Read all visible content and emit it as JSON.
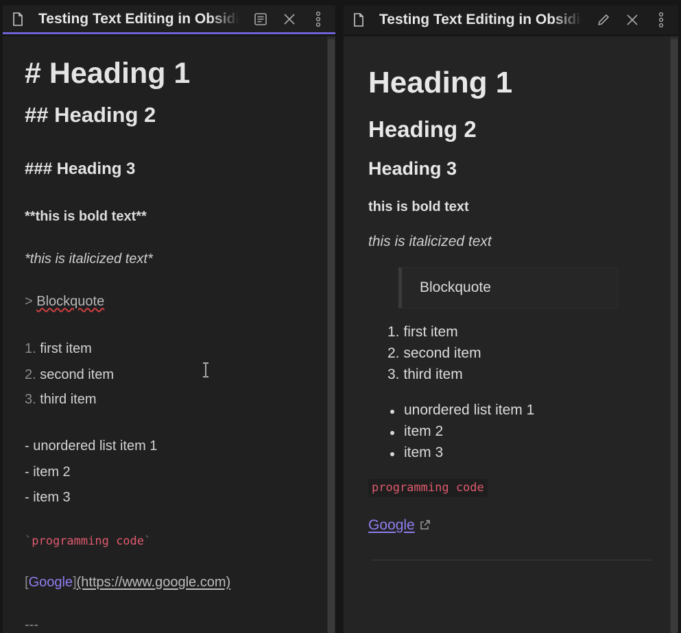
{
  "editor": {
    "tab_title": "Testing Text Editing in Obsidian",
    "lines": {
      "h1": "# Heading 1",
      "h2": "## Heading 2",
      "h3": "### Heading 3",
      "bold": "**this is bold text**",
      "italic": "*this is italicized text*",
      "quote_marker": "> ",
      "quote_text": "Blockquote",
      "ol": [
        {
          "num": "1.",
          "text": " first item"
        },
        {
          "num": "2.",
          "text": " second item"
        },
        {
          "num": "3.",
          "text": " third item"
        }
      ],
      "ul": [
        "- unordered list item 1",
        "- item 2",
        "- item 3"
      ],
      "code_tick": "`",
      "code_text": "programming code",
      "link_open": "[",
      "link_text": "Google",
      "link_close": "]",
      "link_url": "(https://www.google.com)",
      "hr": "---"
    }
  },
  "preview": {
    "tab_title": "Testing Text Editing in Obsidian",
    "h1": "Heading 1",
    "h2": "Heading 2",
    "h3": "Heading 3",
    "bold": "this is bold text",
    "italic": "this is italicized text",
    "blockquote": "Blockquote",
    "ol": [
      {
        "num": "1.",
        "text": "first item"
      },
      {
        "num": "2.",
        "text": "second item"
      },
      {
        "num": "3.",
        "text": "third item"
      }
    ],
    "ul": [
      "unordered list item 1",
      "item 2",
      "item 3"
    ],
    "code": "programming code",
    "link": "Google"
  },
  "icons": {
    "file": "file-icon",
    "reading_view": "reading-view-icon",
    "edit": "pencil-icon",
    "close": "close-icon",
    "more": "more-options-icon",
    "external_link": "external-link-icon",
    "text_cursor": "text-cursor-icon"
  },
  "colors": {
    "accent": "#6f63d6",
    "link": "#8e7ff0",
    "code": "#e05a6d",
    "background": "#202020"
  }
}
